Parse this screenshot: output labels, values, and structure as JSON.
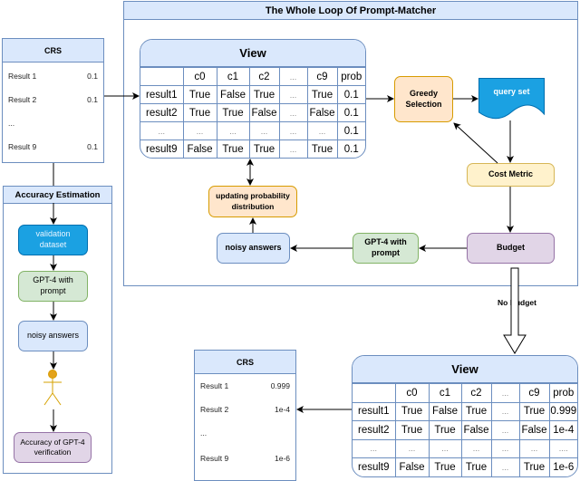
{
  "main_loop": {
    "title": "The Whole Loop Of Prompt-Matcher"
  },
  "crs_initial": {
    "title": "CRS",
    "rows": [
      {
        "label": "Result 1",
        "value": "0.1"
      },
      {
        "label": "Result 2",
        "value": "0.1"
      },
      {
        "label": "...",
        "value": ""
      },
      {
        "label": "Result 9",
        "value": "0.1"
      }
    ]
  },
  "accuracy_estimation": {
    "title": "Accuracy Estimation",
    "steps": {
      "validation": "validation dataset",
      "gpt": "GPT-4 with prompt",
      "noisy": "noisy answers",
      "actor_icon": "person-icon",
      "accuracy": "Accuracy of GPT-4 verification"
    }
  },
  "view_initial": {
    "title": "View",
    "headers": [
      "",
      "c0",
      "c1",
      "c2",
      "...",
      "c9",
      "prob"
    ],
    "rows": [
      [
        "result1",
        "True",
        "False",
        "True",
        "...",
        "True",
        "0.1"
      ],
      [
        "result2",
        "True",
        "True",
        "False",
        "...",
        "False",
        "0.1"
      ],
      [
        "...",
        "...",
        "...",
        "...",
        "...",
        "...",
        "0.1"
      ],
      [
        "result9",
        "False",
        "True",
        "True",
        "...",
        "True",
        "0.1"
      ]
    ]
  },
  "loop_nodes": {
    "greedy": "Greedy Selection",
    "query_set": "query  set",
    "cost_metric": "Cost  Metric",
    "budget": "Budget",
    "gpt": "GPT-4 with prompt",
    "noisy": "noisy answers",
    "update": "updating probability distribution"
  },
  "edge_labels": {
    "no_budget": "No Budget"
  },
  "view_final": {
    "title": "View",
    "headers": [
      "",
      "c0",
      "c1",
      "c2",
      "...",
      "c9",
      "prob"
    ],
    "rows": [
      [
        "result1",
        "True",
        "False",
        "True",
        "...",
        "True",
        "0.999"
      ],
      [
        "result2",
        "True",
        "True",
        "False",
        "...",
        "False",
        "1e-4"
      ],
      [
        "...",
        "...",
        "...",
        "...",
        "...",
        "...",
        "...."
      ],
      [
        "result9",
        "False",
        "True",
        "True",
        "...",
        "True",
        "1e-6"
      ]
    ]
  },
  "crs_final": {
    "title": "CRS",
    "rows": [
      {
        "label": "Result 1",
        "value": "0.999"
      },
      {
        "label": "Result 2",
        "value": "1e-4"
      },
      {
        "label": "...",
        "value": ""
      },
      {
        "label": "Result 9",
        "value": "1e-6"
      }
    ]
  }
}
